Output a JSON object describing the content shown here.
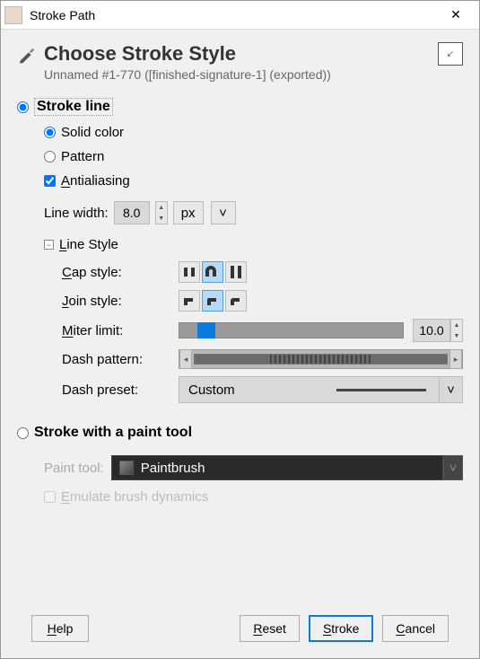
{
  "titlebar": {
    "title": "Stroke Path"
  },
  "header": {
    "title": "Choose Stroke Style",
    "subtitle": "Unnamed #1-770 ([finished-signature-1] (exported))"
  },
  "stroke_line": {
    "label": "Stroke line",
    "solid_label": "Solid color",
    "pattern_label": "Pattern",
    "antialias_label": "ntialiasing",
    "antialias_mnemonic": "A",
    "line_width_label": "Line width:",
    "line_width_value": "8.0",
    "line_width_unit": "px",
    "line_style_label": "ine Style",
    "line_style_mnemonic": "L",
    "cap_label": "ap style:",
    "cap_mnemonic": "C",
    "join_label": "oin style:",
    "join_mnemonic": "J",
    "miter_label": "iter limit:",
    "miter_mnemonic": "M",
    "miter_value": "10.0",
    "dash_pattern_label": "Dash pattern:",
    "dash_preset_label": "Dash preset:",
    "dash_preset_value": "Custom"
  },
  "paint_tool": {
    "section_label": "Stroke with a paint tool",
    "label": "Paint tool:",
    "value": "Paintbrush",
    "emulate_label": "mulate brush dynamics",
    "emulate_mnemonic": "E"
  },
  "buttons": {
    "help": "elp",
    "help_mnemonic": "H",
    "reset": "eset",
    "reset_mnemonic": "R",
    "stroke": "troke",
    "stroke_mnemonic": "S",
    "cancel": "ancel",
    "cancel_mnemonic": "C"
  }
}
